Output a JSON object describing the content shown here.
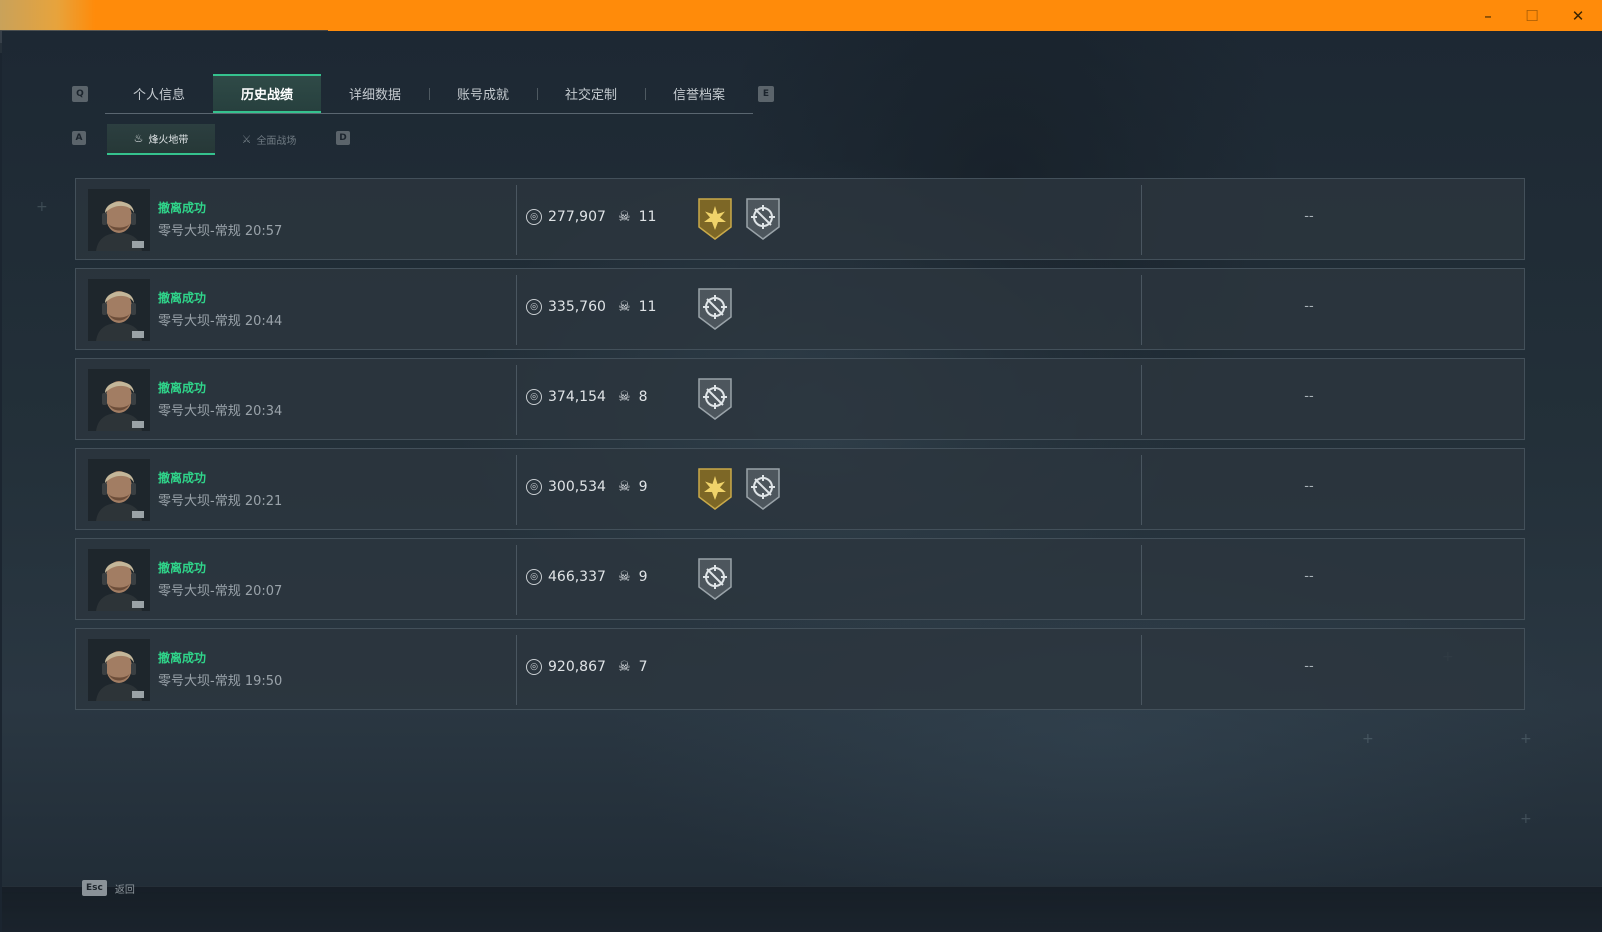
{
  "window": {
    "min_icon": "minimize-icon",
    "max_icon": "maximize-icon",
    "close_icon": "close-icon",
    "min_glyph": "–",
    "max_glyph": "☐",
    "close_glyph": "✕"
  },
  "tabs": {
    "prev_key": "Q",
    "next_key": "E",
    "items": [
      {
        "label": "个人信息"
      },
      {
        "label": "历史战绩"
      },
      {
        "label": "详细数据"
      },
      {
        "label": "账号成就"
      },
      {
        "label": "社交定制"
      },
      {
        "label": "信誉档案"
      }
    ],
    "active_index": 1
  },
  "subtabs": {
    "prev_key": "A",
    "next_key": "D",
    "items": [
      {
        "label": "烽火地带",
        "icon": "flame-mode-icon"
      },
      {
        "label": "全面战场",
        "icon": "battlefield-mode-icon"
      }
    ],
    "active_index": 0
  },
  "records": [
    {
      "status": "撤离成功",
      "map": "零号大坝-常规",
      "time": "20:57",
      "money": "277,907",
      "kills": "11",
      "badges": [
        "gold-star",
        "silver-crosshair"
      ],
      "extra": "--"
    },
    {
      "status": "撤离成功",
      "map": "零号大坝-常规",
      "time": "20:44",
      "money": "335,760",
      "kills": "11",
      "badges": [
        "silver-crosshair"
      ],
      "extra": "--"
    },
    {
      "status": "撤离成功",
      "map": "零号大坝-常规",
      "time": "20:34",
      "money": "374,154",
      "kills": "8",
      "badges": [
        "silver-crosshair"
      ],
      "extra": "--"
    },
    {
      "status": "撤离成功",
      "map": "零号大坝-常规",
      "time": "20:21",
      "money": "300,534",
      "kills": "9",
      "badges": [
        "gold-star",
        "silver-crosshair"
      ],
      "extra": "--"
    },
    {
      "status": "撤离成功",
      "map": "零号大坝-常规",
      "time": "20:07",
      "money": "466,337",
      "kills": "9",
      "badges": [
        "silver-crosshair"
      ],
      "extra": "--"
    },
    {
      "status": "撤离成功",
      "map": "零号大坝-常规",
      "time": "19:50",
      "money": "920,867",
      "kills": "7",
      "badges": [],
      "extra": "--"
    }
  ],
  "footer": {
    "esc_key": "Esc",
    "esc_label": "返回"
  },
  "colors": {
    "titlebar": "#ff8b0a",
    "accent_green": "#35c28e",
    "status_green": "#2fd58a",
    "badge_gold": "#b8953a",
    "badge_silver": "#8d969c"
  }
}
